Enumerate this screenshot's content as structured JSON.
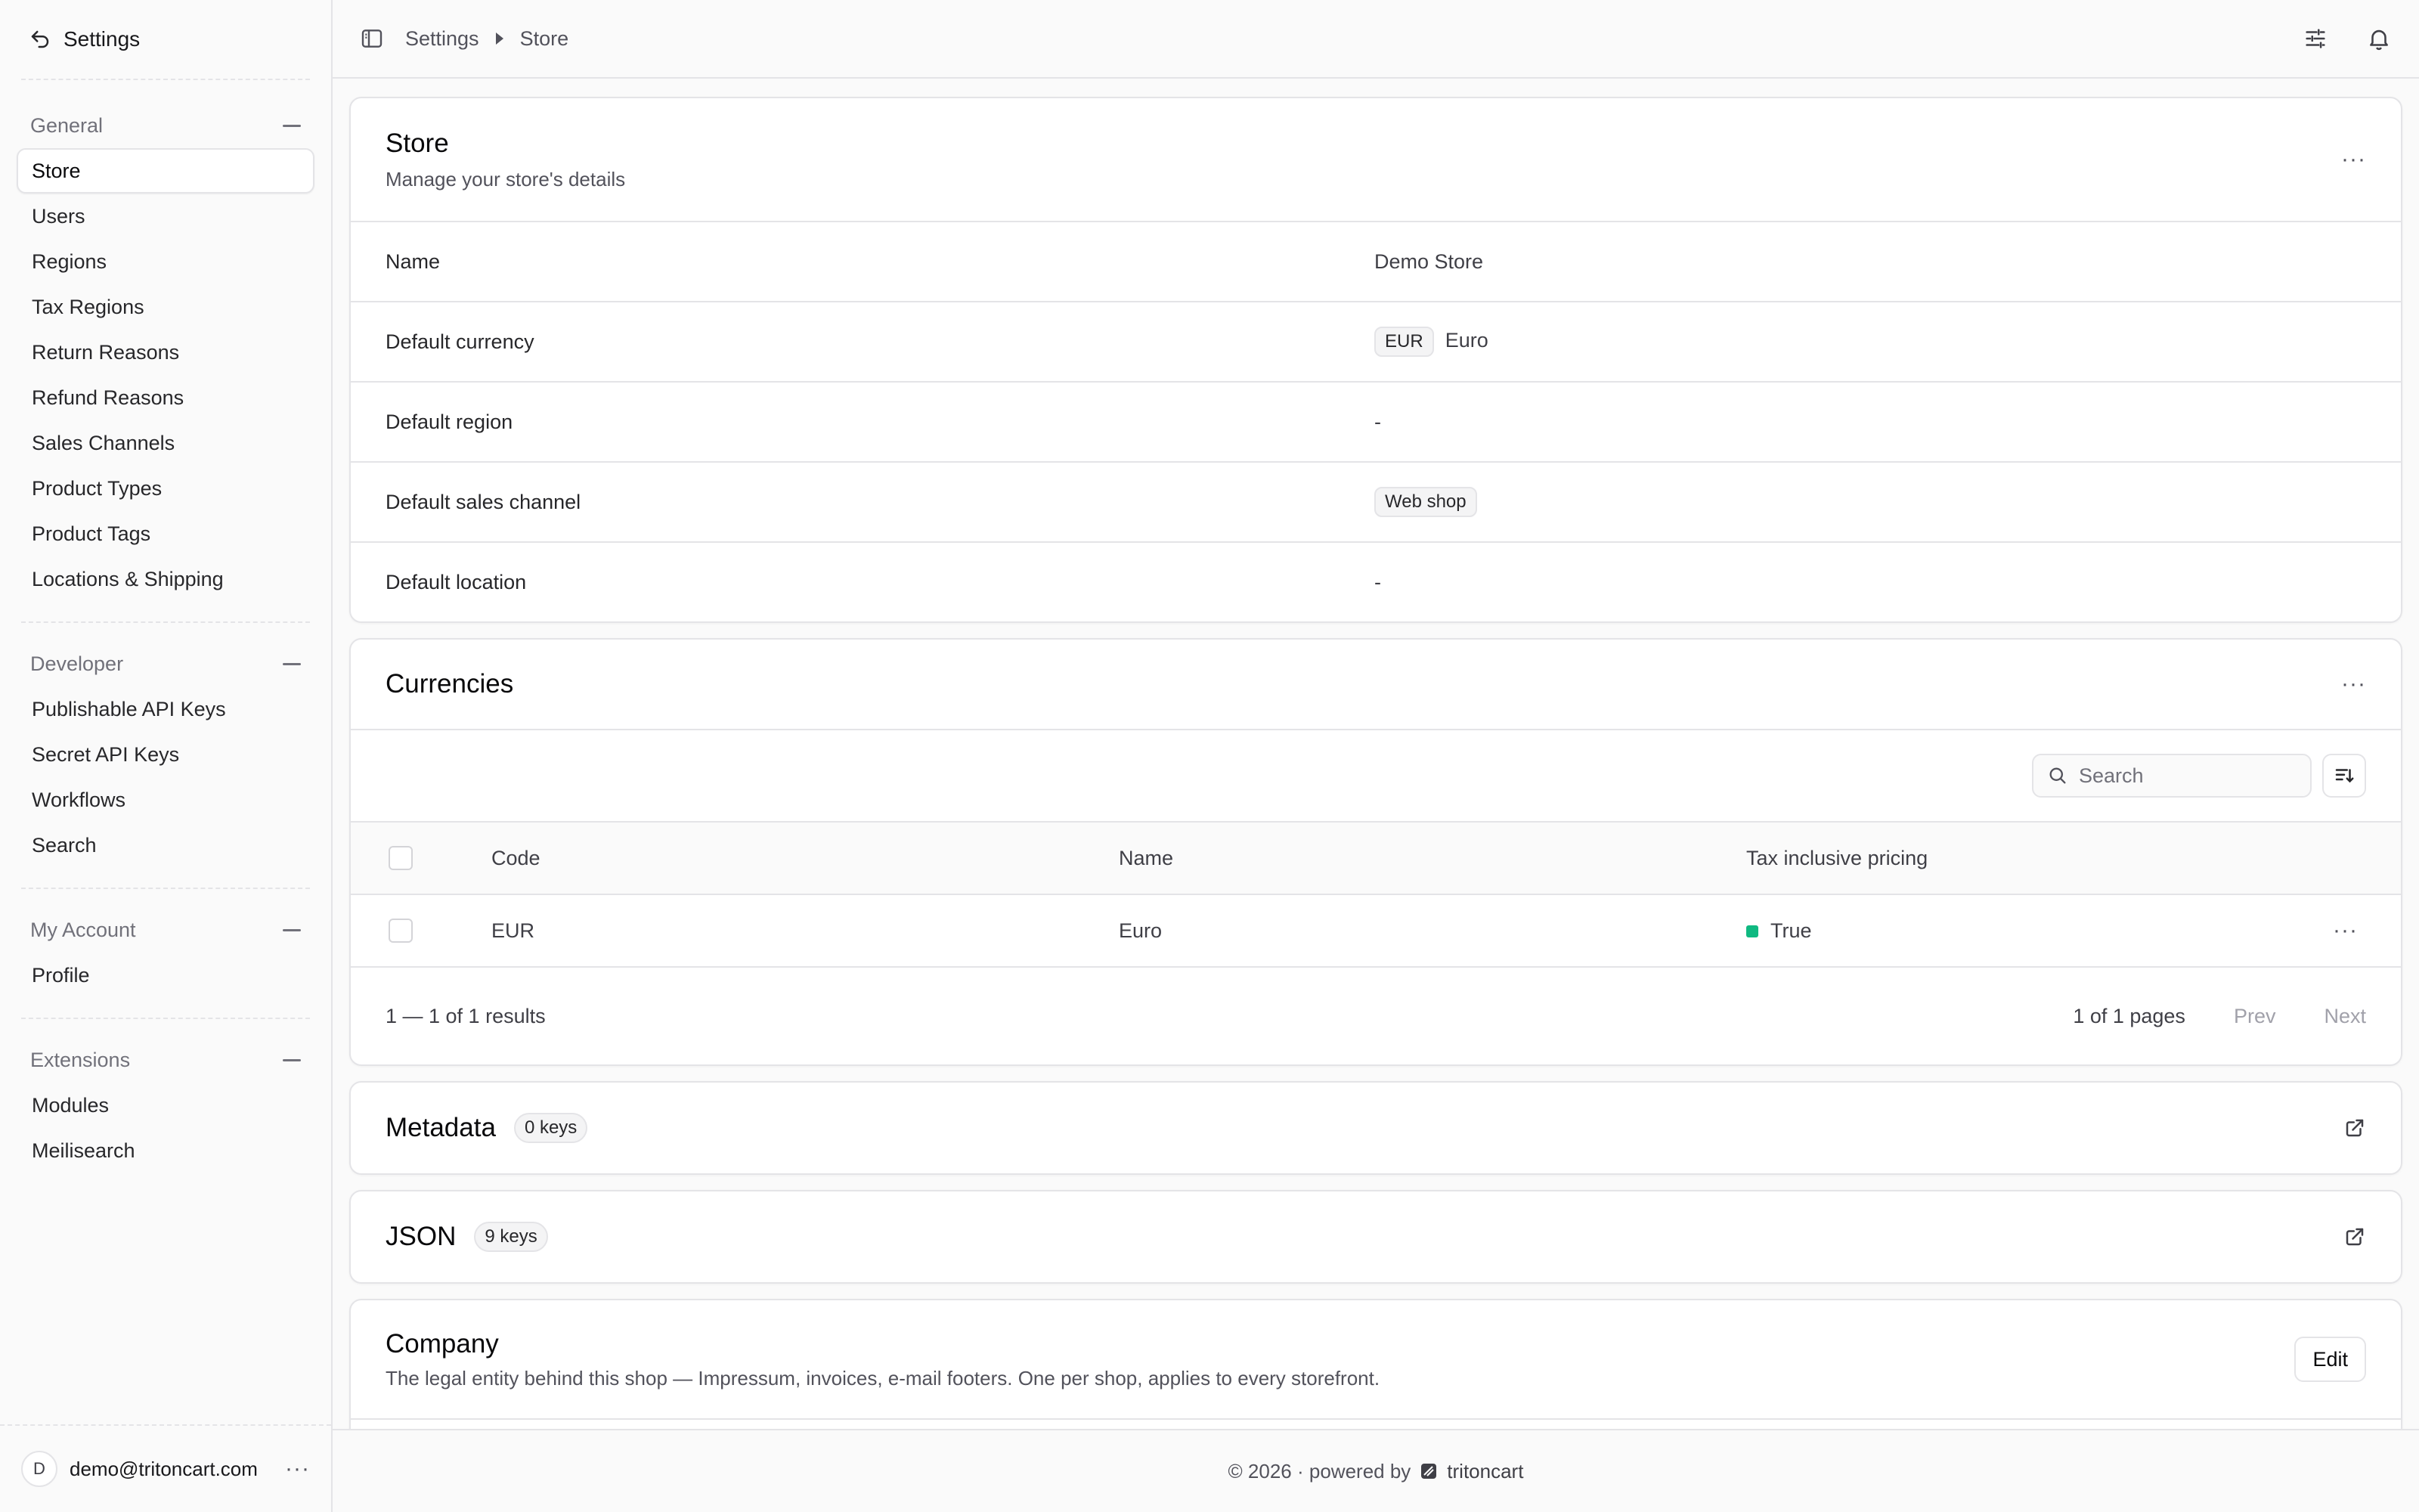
{
  "sidebar": {
    "header_title": "Settings",
    "sections": [
      {
        "label": "General",
        "items": [
          "Store",
          "Users",
          "Regions",
          "Tax Regions",
          "Return Reasons",
          "Refund Reasons",
          "Sales Channels",
          "Product Types",
          "Product Tags",
          "Locations & Shipping"
        ]
      },
      {
        "label": "Developer",
        "items": [
          "Publishable API Keys",
          "Secret API Keys",
          "Workflows",
          "Search"
        ]
      },
      {
        "label": "My Account",
        "items": [
          "Profile"
        ]
      },
      {
        "label": "Extensions",
        "items": [
          "Modules",
          "Meilisearch"
        ]
      }
    ],
    "active_item": "Store",
    "user": {
      "initial": "D",
      "email": "demo@tritoncart.com"
    }
  },
  "topbar": {
    "breadcrumb": [
      "Settings",
      "Store"
    ]
  },
  "store_card": {
    "title": "Store",
    "subtitle": "Manage your store's details",
    "rows": [
      {
        "label": "Name",
        "value": "Demo Store"
      },
      {
        "label": "Default currency",
        "badge": "EUR",
        "value": "Euro"
      },
      {
        "label": "Default region",
        "value": "-"
      },
      {
        "label": "Default sales channel",
        "badge": "Web shop"
      },
      {
        "label": "Default location",
        "value": "-"
      }
    ]
  },
  "currencies_card": {
    "title": "Currencies",
    "search_placeholder": "Search",
    "columns": [
      "Code",
      "Name",
      "Tax inclusive pricing"
    ],
    "rows": [
      {
        "code": "EUR",
        "name": "Euro",
        "tax_inclusive": "True"
      }
    ],
    "results_text": "1 — 1 of 1 results",
    "pages_text": "1 of 1 pages",
    "prev_label": "Prev",
    "next_label": "Next",
    "status_color": "#10b981"
  },
  "metadata_card": {
    "title": "Metadata",
    "badge": "0 keys"
  },
  "json_card": {
    "title": "JSON",
    "badge": "9 keys"
  },
  "company_card": {
    "title": "Company",
    "subtitle": "The legal entity behind this shop — Impressum, invoices, e-mail footers. One per shop, applies to every storefront.",
    "edit_label": "Edit"
  },
  "footer": {
    "text": "© 2026 · powered by",
    "brand": "tritoncart"
  }
}
